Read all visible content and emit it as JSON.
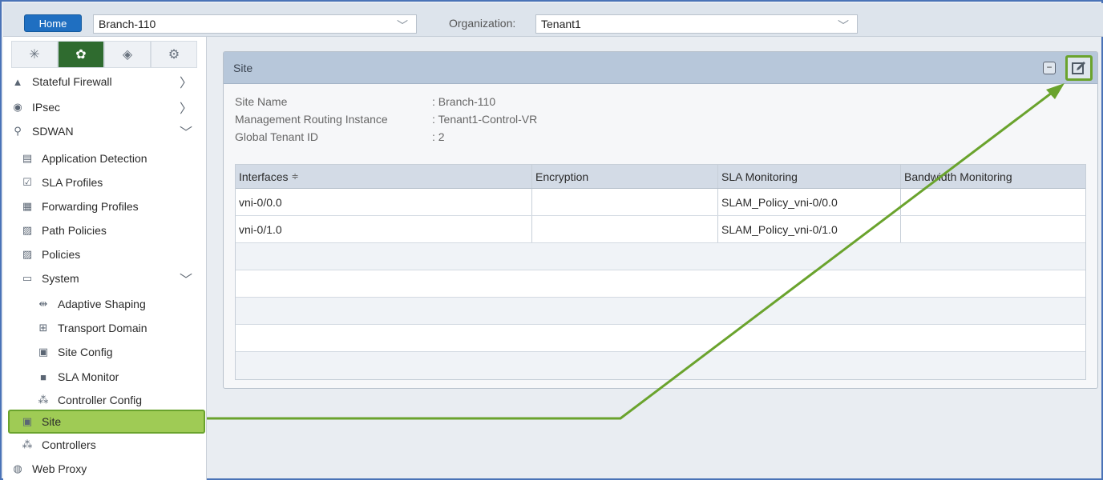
{
  "topbar": {
    "home_label": "Home",
    "device_value": "Branch-110",
    "org_label": "Organization:",
    "org_value": "Tenant1"
  },
  "sidebar": {
    "items": [
      {
        "label": "Stateful Firewall",
        "icon": "firewall-icon"
      },
      {
        "label": "IPsec",
        "icon": "ipsec-icon"
      },
      {
        "label": "SDWAN",
        "icon": "sdwan-icon"
      },
      {
        "label": "Application Detection",
        "icon": "app-detection-icon"
      },
      {
        "label": "SLA Profiles",
        "icon": "sla-profiles-icon"
      },
      {
        "label": "Forwarding Profiles",
        "icon": "forwarding-profiles-icon"
      },
      {
        "label": "Path Policies",
        "icon": "path-policies-icon"
      },
      {
        "label": "Policies",
        "icon": "policies-icon"
      },
      {
        "label": "System",
        "icon": "system-icon"
      },
      {
        "label": "Adaptive Shaping",
        "icon": "adaptive-shaping-icon"
      },
      {
        "label": "Transport Domain",
        "icon": "transport-domain-icon"
      },
      {
        "label": "Site Config",
        "icon": "site-config-icon"
      },
      {
        "label": "SLA Monitor",
        "icon": "sla-monitor-icon"
      },
      {
        "label": "Controller Config",
        "icon": "controller-config-icon"
      },
      {
        "label": "Site",
        "icon": "site-icon"
      },
      {
        "label": "Controllers",
        "icon": "controllers-icon"
      },
      {
        "label": "Web Proxy",
        "icon": "web-proxy-icon"
      }
    ]
  },
  "panel": {
    "title": "Site",
    "fields": [
      {
        "label": "Site Name",
        "value": ": Branch-110"
      },
      {
        "label": "Management Routing Instance",
        "value": ": Tenant1-Control-VR"
      },
      {
        "label": "Global Tenant ID",
        "value": ": 2"
      }
    ],
    "table": {
      "columns": [
        "Interfaces",
        "Encryption",
        "SLA Monitoring",
        "Bandwidth Monitoring"
      ],
      "sort_glyph": "≑",
      "rows": [
        [
          "vni-0/0.0",
          "",
          "SLAM_Policy_vni-0/0.0",
          ""
        ],
        [
          "vni-0/1.0",
          "",
          "SLAM_Policy_vni-0/1.0",
          ""
        ]
      ]
    }
  },
  "colors": {
    "highlight_green": "#6aa32d",
    "home_blue": "#1f6fc1",
    "panel_header": "#b7c7da"
  }
}
